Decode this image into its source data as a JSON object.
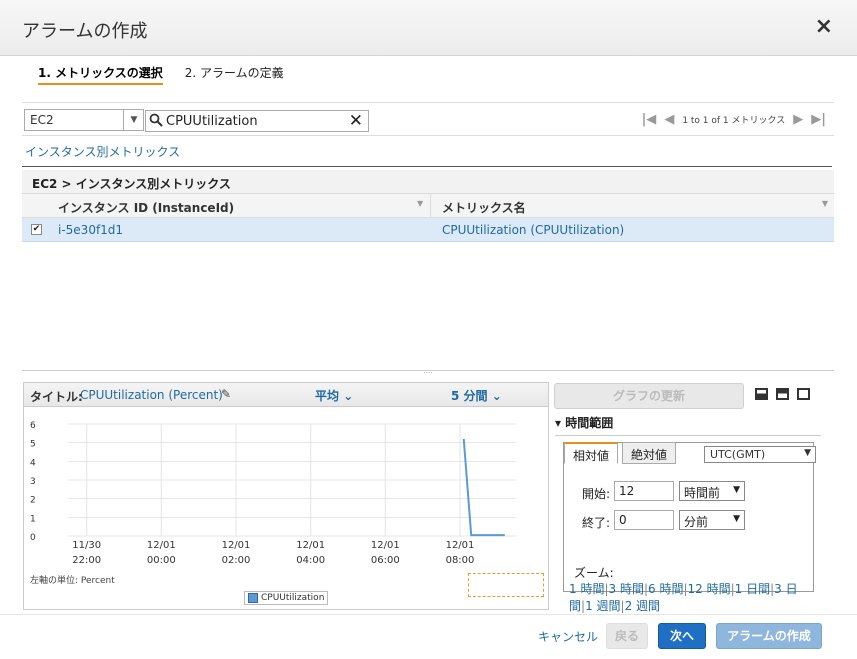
{
  "dialog": {
    "title": "アラームの作成",
    "close_icon": "×"
  },
  "steps": [
    {
      "label": "1. メトリックスの選択",
      "active": true
    },
    {
      "label": "2. アラームの定義",
      "active": false
    }
  ],
  "toolbar": {
    "namespace": "EC2",
    "search_value": "CPUUtilization",
    "pager_text": "1 to 1 of 1 メトリックス"
  },
  "link_by_instance": "インスタンス別メトリックス",
  "grid": {
    "breadcrumb": "EC2 > インスタンス別メトリックス",
    "columns": [
      "インスタンス ID (InstanceId)",
      "メトリックス名"
    ],
    "rows": [
      {
        "checked": true,
        "instance_id": "i-5e30f1d1",
        "metric_name": "CPUUtilization (CPUUtilization)"
      }
    ]
  },
  "chart_panel": {
    "title_label": "タイトル:",
    "title_value": "CPUUtilization (Percent)",
    "statistic": "平均",
    "period": "5 分間",
    "unit_label": "左軸の単位: Percent",
    "legend": "CPUUtilization"
  },
  "chart_data": {
    "type": "line",
    "y_ticks": [
      "0",
      "1",
      "2",
      "3",
      "4",
      "5",
      "6"
    ],
    "ylim": [
      0,
      6
    ],
    "x_ticks": [
      {
        "date": "11/30",
        "time": "22:00"
      },
      {
        "date": "12/01",
        "time": "00:00"
      },
      {
        "date": "12/01",
        "time": "02:00"
      },
      {
        "date": "12/01",
        "time": "04:00"
      },
      {
        "date": "12/01",
        "time": "06:00"
      },
      {
        "date": "12/01",
        "time": "08:00"
      }
    ],
    "xlim_hours": [
      -2.5,
      9.5
    ],
    "series": [
      {
        "name": "CPUUtilization",
        "color": "#5b9bd5",
        "x_hours": [
          8.1,
          8.3,
          9.2
        ],
        "y": [
          5.2,
          0.05,
          0.05
        ]
      }
    ],
    "grid": true
  },
  "update_button": "グラフの更新",
  "time_range": {
    "heading": "時間範囲",
    "tabs": [
      "相対値",
      "絶対値"
    ],
    "timezone": "UTC(GMT)",
    "start_label": "開始:",
    "start_value": "12",
    "start_unit": "時間前",
    "end_label": "終了:",
    "end_value": "0",
    "end_unit": "分前",
    "zoom_label": "ズーム:",
    "zoom_options": [
      "1 時間",
      "3 時間",
      "6 時間",
      "12 時間",
      "1 日間",
      "3 日間",
      "1 週間",
      "2 週間"
    ]
  },
  "footer": {
    "cancel": "キャンセル",
    "back": "戻る",
    "next": "次へ",
    "create": "アラームの作成"
  }
}
